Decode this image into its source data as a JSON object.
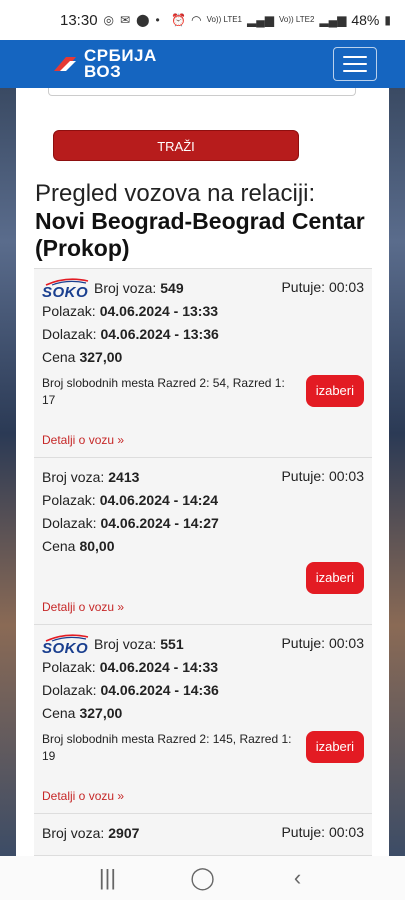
{
  "status_bar": {
    "time": "13:30",
    "battery": "48%",
    "sim1": "Vo)) LTE1",
    "sim2": "Vo)) LTE2"
  },
  "header": {
    "logo_line1": "СРБИЈА",
    "logo_line2": "ВОЗ"
  },
  "search": {
    "button_label": "TRAŽI"
  },
  "heading": {
    "line1": "Pregled vozova na relaciji:",
    "line2": "Novi Beograd-Beograd Centar (Prokop)"
  },
  "labels": {
    "train_no": "Broj voza:",
    "departure": "Polazak:",
    "arrival": "Dolazak:",
    "price": "Cena",
    "travel": "Putuje:",
    "select": "izaberi",
    "details": "Detalji o vozu »",
    "soko": "SOKO"
  },
  "trains": [
    {
      "number": "549",
      "departure": "04.06.2024 - 13:33",
      "arrival": "04.06.2024 - 13:36",
      "price": "327,00",
      "duration": "00:03",
      "soko": true,
      "free_seats": "Broj slobodnih mesta Razred 2: 54, Razred 1: 17"
    },
    {
      "number": "2413",
      "departure": "04.06.2024 - 14:24",
      "arrival": "04.06.2024 - 14:27",
      "price": "80,00",
      "duration": "00:03",
      "soko": false,
      "free_seats": ""
    },
    {
      "number": "551",
      "departure": "04.06.2024 - 14:33",
      "arrival": "04.06.2024 - 14:36",
      "price": "327,00",
      "duration": "00:03",
      "soko": true,
      "free_seats": "Broj slobodnih mesta Razred 2: 145, Razred 1: 19"
    },
    {
      "number": "2907",
      "duration": "00:03"
    }
  ],
  "colors": {
    "navbar": "#1565c0",
    "search_button": "#b71c1c",
    "select_button": "#e31b23",
    "link": "#c62828"
  }
}
